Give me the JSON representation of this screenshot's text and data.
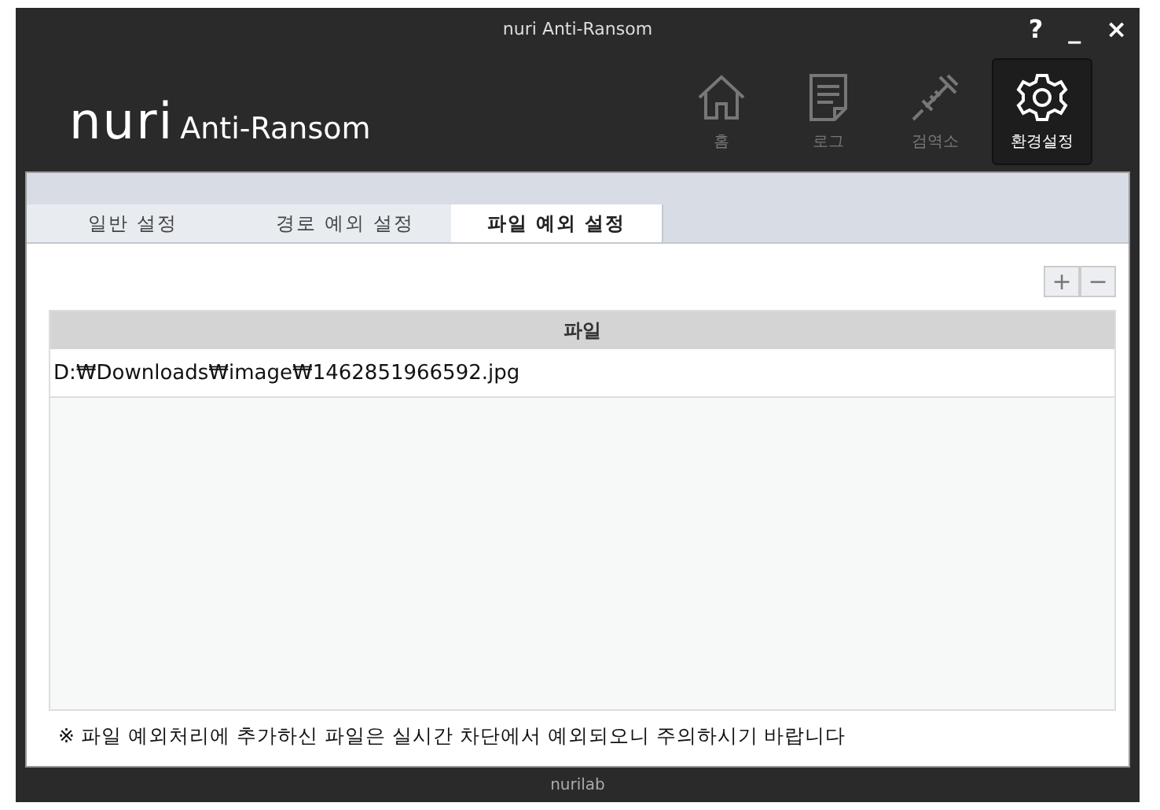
{
  "window": {
    "title": "nuri Anti-Ransom",
    "controls": [
      "?",
      "_",
      "×"
    ]
  },
  "logo": {
    "mark": "nuri",
    "name": "Anti-Ransom"
  },
  "nav": [
    {
      "kind": "home",
      "label": "홈",
      "selected": false
    },
    {
      "kind": "log",
      "label": "로그",
      "selected": false
    },
    {
      "kind": "quarantine",
      "label": "검역소",
      "selected": false
    },
    {
      "kind": "settings",
      "label": "환경설정",
      "selected": true
    }
  ],
  "tabs": [
    {
      "label": "일반 설정",
      "selected": false
    },
    {
      "label": "경로 예외 설정",
      "selected": false
    },
    {
      "label": "파일 예외 설정",
      "selected": true
    }
  ],
  "toolbar": [
    "+",
    "−"
  ],
  "table": {
    "columns": [
      "파일"
    ],
    "rows": [
      [
        "D:₩Downloads₩image₩1462851966592.jpg"
      ]
    ]
  },
  "notice": "※ 파일 예외처리에 추가하신 파일은 실시간 차단에서 예외되오니 주의하시기 바랍니다",
  "footer": "nurilab"
}
